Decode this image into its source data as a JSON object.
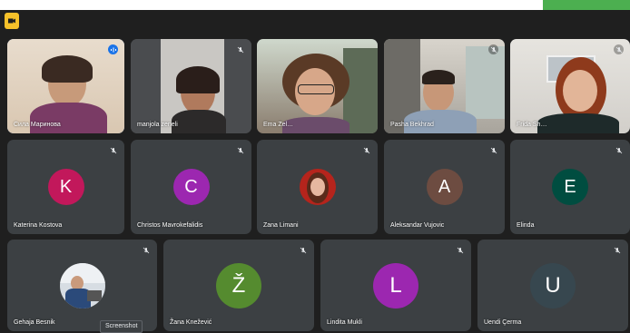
{
  "participants": [
    {
      "name": "Сила Маринова",
      "mic": "speaking"
    },
    {
      "name": "manjola zeneli",
      "mic": "muted"
    },
    {
      "name": "Ema Zel…",
      "mic": "none"
    },
    {
      "name": "Pasha Bekhrad",
      "mic": "muted"
    },
    {
      "name": "Frida Sh…",
      "mic": "muted"
    },
    {
      "name": "Katerina Kostova",
      "initial": "K",
      "color": "#c2185b",
      "mic": "muted"
    },
    {
      "name": "Christos Mavrokefalidis",
      "initial": "C",
      "color": "#9c27b0",
      "mic": "muted"
    },
    {
      "name": "Zana Limani",
      "mic": "muted"
    },
    {
      "name": "Aleksandar Vujovic",
      "initial": "A",
      "color": "#6d4c41",
      "mic": "muted"
    },
    {
      "name": "Elinda",
      "initial": "E",
      "color": "#004d40",
      "mic": "muted"
    },
    {
      "name": "Gehaja Besnik",
      "mic": "muted"
    },
    {
      "name": "Žana Knežević",
      "initial": "Ž",
      "color": "#558b2f",
      "mic": "muted"
    },
    {
      "name": "Lindita Mukli",
      "initial": "L",
      "color": "#9c27b0",
      "mic": "muted"
    },
    {
      "name": "Uendi Çerma",
      "initial": "U",
      "color": "#37474f",
      "mic": "muted"
    }
  ],
  "tooltip": "Screenshot",
  "colors": {
    "background": "#1f1f1f",
    "tile": "#3c4043",
    "active_outline": "#8ab4f8",
    "accent_green": "#4caf50"
  }
}
